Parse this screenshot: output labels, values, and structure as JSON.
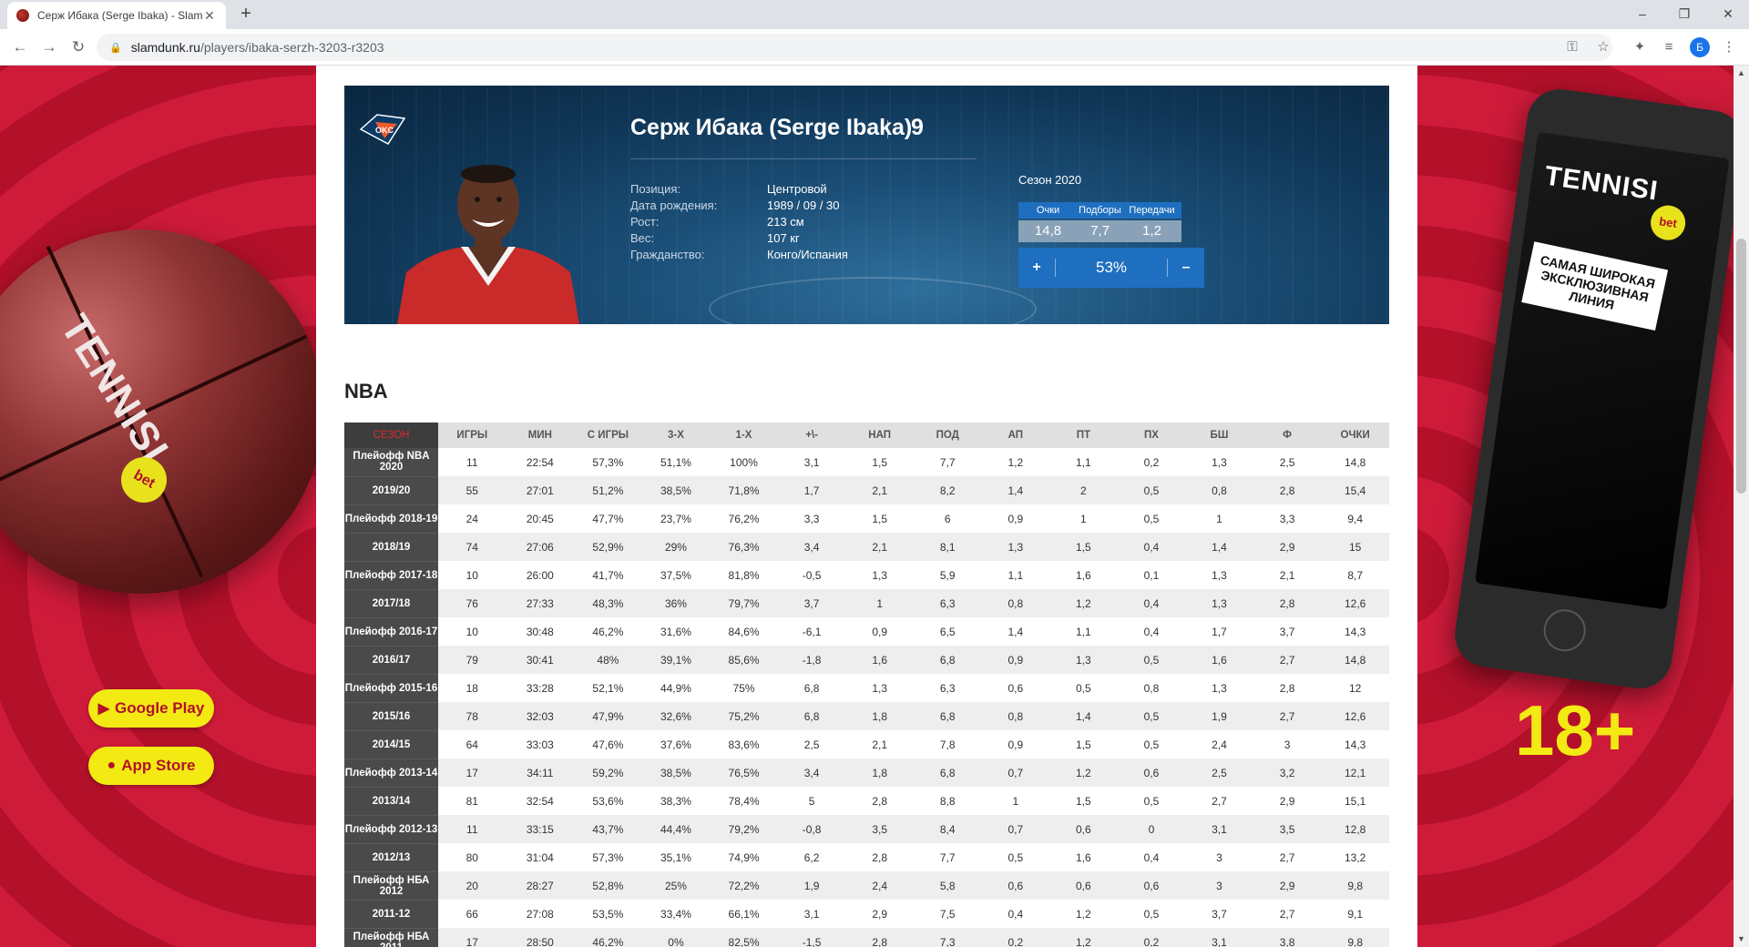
{
  "browser": {
    "tab_title": "Серж Ибака (Serge Ibaka) - Slam",
    "tab_close": "✕",
    "new_tab": "+",
    "url_host": "slamdunk.ru",
    "url_path": "/players/ibaka-serzh-3203-r3203",
    "profile_initial": "Б",
    "win_min": "–",
    "win_max": "❐",
    "win_close": "✕"
  },
  "banner_left": {
    "logo": "TENNISI",
    "bet": "bet",
    "google_play": "Google Play",
    "app_store": "App Store"
  },
  "banner_right": {
    "logo": "TENNISI",
    "bet": "bet",
    "slogan": "САМАЯ ШИРОКАЯ ЭКСКЛЮЗИВНАЯ ЛИНИЯ",
    "age": "18+"
  },
  "player": {
    "name": "Серж Ибака (Serge Ibaka)",
    "number": "9",
    "info": [
      {
        "label": "Позиция:",
        "value": "Центровой"
      },
      {
        "label": "Дата рождения:",
        "value": "1989 / 09 / 30"
      },
      {
        "label": "Рост:",
        "value": "213 см"
      },
      {
        "label": "Вес:",
        "value": "107 кг"
      },
      {
        "label": "Гражданство:",
        "value": "Конго/Испания"
      }
    ],
    "season_title": "Сезон 2020",
    "season_stats": [
      {
        "label": "Очки",
        "value": "14,8"
      },
      {
        "label": "Подборы",
        "value": "7,7"
      },
      {
        "label": "Передачи",
        "value": "1,2"
      }
    ],
    "rating": {
      "plus": "+",
      "value": "53%",
      "minus": "–"
    }
  },
  "section_title": "NBA",
  "table": {
    "headers": [
      "СЕЗОН",
      "ИГРЫ",
      "МИН",
      "С ИГРЫ",
      "3-Х",
      "1-Х",
      "+\\-",
      "НАП",
      "ПОД",
      "АП",
      "ПТ",
      "ПХ",
      "БШ",
      "Ф",
      "ОЧКИ"
    ],
    "rows": [
      [
        "Плейофф NBA 2020",
        "11",
        "22:54",
        "57,3%",
        "51,1%",
        "100%",
        "3,1",
        "1,5",
        "7,7",
        "1,2",
        "1,1",
        "0,2",
        "1,3",
        "2,5",
        "14,8"
      ],
      [
        "2019/20",
        "55",
        "27:01",
        "51,2%",
        "38,5%",
        "71,8%",
        "1,7",
        "2,1",
        "8,2",
        "1,4",
        "2",
        "0,5",
        "0,8",
        "2,8",
        "15,4"
      ],
      [
        "Плейофф 2018-19",
        "24",
        "20:45",
        "47,7%",
        "23,7%",
        "76,2%",
        "3,3",
        "1,5",
        "6",
        "0,9",
        "1",
        "0,5",
        "1",
        "3,3",
        "9,4"
      ],
      [
        "2018/19",
        "74",
        "27:06",
        "52,9%",
        "29%",
        "76,3%",
        "3,4",
        "2,1",
        "8,1",
        "1,3",
        "1,5",
        "0,4",
        "1,4",
        "2,9",
        "15"
      ],
      [
        "Плейофф 2017-18",
        "10",
        "26:00",
        "41,7%",
        "37,5%",
        "81,8%",
        "-0,5",
        "1,3",
        "5,9",
        "1,1",
        "1,6",
        "0,1",
        "1,3",
        "2,1",
        "8,7"
      ],
      [
        "2017/18",
        "76",
        "27:33",
        "48,3%",
        "36%",
        "79,7%",
        "3,7",
        "1",
        "6,3",
        "0,8",
        "1,2",
        "0,4",
        "1,3",
        "2,8",
        "12,6"
      ],
      [
        "Плейофф 2016-17",
        "10",
        "30:48",
        "46,2%",
        "31,6%",
        "84,6%",
        "-6,1",
        "0,9",
        "6,5",
        "1,4",
        "1,1",
        "0,4",
        "1,7",
        "3,7",
        "14,3"
      ],
      [
        "2016/17",
        "79",
        "30:41",
        "48%",
        "39,1%",
        "85,6%",
        "-1,8",
        "1,6",
        "6,8",
        "0,9",
        "1,3",
        "0,5",
        "1,6",
        "2,7",
        "14,8"
      ],
      [
        "Плейофф 2015-16",
        "18",
        "33:28",
        "52,1%",
        "44,9%",
        "75%",
        "6,8",
        "1,3",
        "6,3",
        "0,6",
        "0,5",
        "0,8",
        "1,3",
        "2,8",
        "12"
      ],
      [
        "2015/16",
        "78",
        "32:03",
        "47,9%",
        "32,6%",
        "75,2%",
        "6,8",
        "1,8",
        "6,8",
        "0,8",
        "1,4",
        "0,5",
        "1,9",
        "2,7",
        "12,6"
      ],
      [
        "2014/15",
        "64",
        "33:03",
        "47,6%",
        "37,6%",
        "83,6%",
        "2,5",
        "2,1",
        "7,8",
        "0,9",
        "1,5",
        "0,5",
        "2,4",
        "3",
        "14,3"
      ],
      [
        "Плейофф 2013-14",
        "17",
        "34:11",
        "59,2%",
        "38,5%",
        "76,5%",
        "3,4",
        "1,8",
        "6,8",
        "0,7",
        "1,2",
        "0,6",
        "2,5",
        "3,2",
        "12,1"
      ],
      [
        "2013/14",
        "81",
        "32:54",
        "53,6%",
        "38,3%",
        "78,4%",
        "5",
        "2,8",
        "8,8",
        "1",
        "1,5",
        "0,5",
        "2,7",
        "2,9",
        "15,1"
      ],
      [
        "Плейофф 2012-13",
        "11",
        "33:15",
        "43,7%",
        "44,4%",
        "79,2%",
        "-0,8",
        "3,5",
        "8,4",
        "0,7",
        "0,6",
        "0",
        "3,1",
        "3,5",
        "12,8"
      ],
      [
        "2012/13",
        "80",
        "31:04",
        "57,3%",
        "35,1%",
        "74,9%",
        "6,2",
        "2,8",
        "7,7",
        "0,5",
        "1,6",
        "0,4",
        "3",
        "2,7",
        "13,2"
      ],
      [
        "Плейофф НБА 2012",
        "20",
        "28:27",
        "52,8%",
        "25%",
        "72,2%",
        "1,9",
        "2,4",
        "5,8",
        "0,6",
        "0,6",
        "0,6",
        "3",
        "2,9",
        "9,8"
      ],
      [
        "2011-12",
        "66",
        "27:08",
        "53,5%",
        "33,4%",
        "66,1%",
        "3,1",
        "2,9",
        "7,5",
        "0,4",
        "1,2",
        "0,5",
        "3,7",
        "2,7",
        "9,1"
      ],
      [
        "Плейофф НБА 2011",
        "17",
        "28:50",
        "46,2%",
        "0%",
        "82,5%",
        "-1,5",
        "2,8",
        "7,3",
        "0,2",
        "1,2",
        "0,2",
        "3,1",
        "3,8",
        "9,8"
      ]
    ]
  }
}
